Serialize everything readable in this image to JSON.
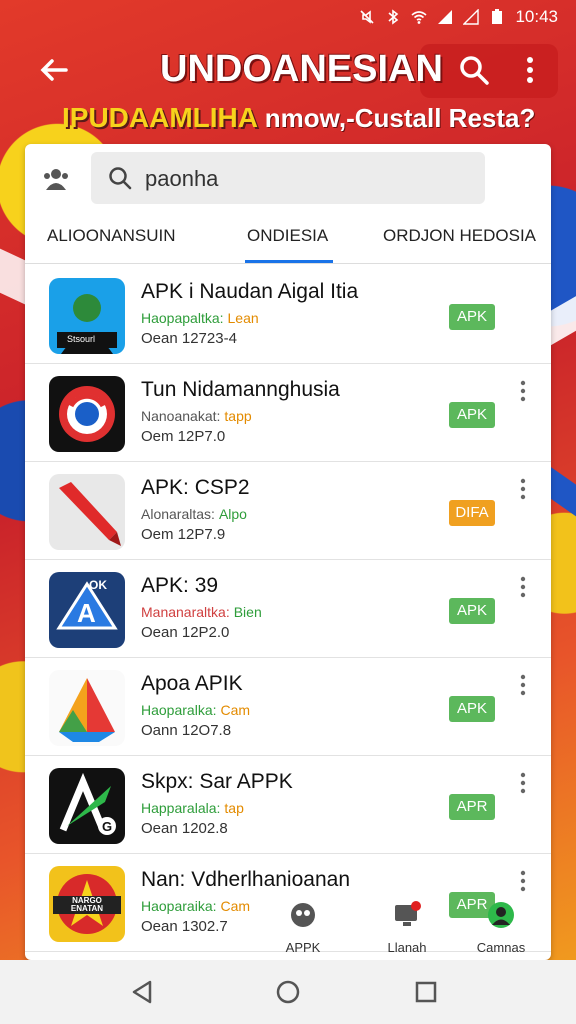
{
  "status_bar": {
    "time": "10:43"
  },
  "app_bar": {
    "title": "UNDOANESIAN",
    "subtitle_main": "IPUDAAMLIHA",
    "subtitle_tail": "nmow,-Custall Resta?"
  },
  "search": {
    "value": "paonha"
  },
  "tabs": [
    {
      "label": "ALIOONANSUIN"
    },
    {
      "label": "ONDIESIA"
    },
    {
      "label": "ORDJON HEDOSIA"
    }
  ],
  "apps": [
    {
      "name": "APK i Naudan Aigal Itia",
      "meta_key": "Haopapaltka:",
      "meta_val": "Lean",
      "date": "Oean 12723-4",
      "badge": "APK",
      "badge_color": "#5cb85c",
      "icon": "person-avatar-icon",
      "icon_text": "Stsourl"
    },
    {
      "name": "Tun Nidamannghusia",
      "meta_key": "Nanoanakat:",
      "meta_val": "tapp",
      "date": "Oem 12P7.0",
      "badge": "APK",
      "badge_color": "#5cb85c",
      "icon": "target-refresh-icon"
    },
    {
      "name": "APK: CSP2",
      "meta_key": "Alonaraltas:",
      "meta_val": "Alpo",
      "date": "Oem 12P7.9",
      "badge": "DIFA",
      "badge_color": "#f0a020",
      "icon": "red-pencil-icon"
    },
    {
      "name": "APK: 39",
      "meta_key": "Mananaraltka:",
      "meta_val": "Bien",
      "date": "Oean 12P2.0",
      "badge": "APK",
      "badge_color": "#5cb85c",
      "icon": "blue-a-logo-icon",
      "icon_text": "OK"
    },
    {
      "name": "Apoa APIK",
      "meta_key": "Haoparalka:",
      "meta_val": "Cam",
      "date": "Oann 12O7.8",
      "badge": "APK",
      "badge_color": "#5cb85c",
      "icon": "colorful-triangle-icon"
    },
    {
      "name": "Skpx: Sar APPK",
      "meta_key": "Happaralala:",
      "meta_val": "tap",
      "date": "Oean 1202.8",
      "badge": "APR",
      "badge_color": "#5cb85c",
      "icon": "rocket-a-icon"
    },
    {
      "name": "Nan: Vdherlhanioanan",
      "meta_key": "Haoparaika:",
      "meta_val": "Cam",
      "date": "Oean 1302.7",
      "badge": "APR",
      "badge_color": "#5cb85c",
      "icon": "star-badge-icon",
      "icon_text": "NARGO ENATAN"
    }
  ],
  "bottom_tabs": [
    {
      "label": "APPK",
      "icon": "controller-icon"
    },
    {
      "label": "Llanah",
      "icon": "monitor-icon"
    },
    {
      "label": "Camnas",
      "icon": "avatar-icon"
    }
  ]
}
